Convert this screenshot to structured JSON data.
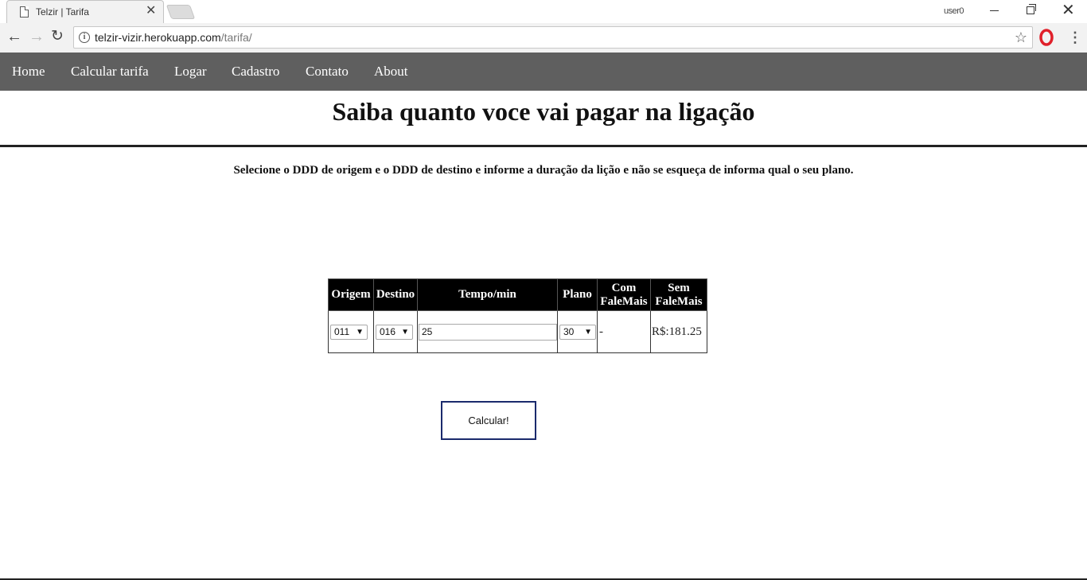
{
  "browser": {
    "tab_title": "Telzir | Tarifa",
    "user_label": "user0",
    "url_host": "telzir-vizir.herokuapp.com",
    "url_path": "/tarifa/"
  },
  "nav": {
    "items": [
      {
        "label": "Home"
      },
      {
        "label": "Calcular tarifa"
      },
      {
        "label": "Logar"
      },
      {
        "label": "Cadastro"
      },
      {
        "label": "Contato"
      },
      {
        "label": "About"
      }
    ]
  },
  "page": {
    "title": "Saiba quanto voce vai pagar na ligação",
    "instructions": "Selecione o DDD de origem e o DDD de destino e informe a duração da lição e não se esqueça de informa qual o seu plano."
  },
  "table": {
    "headers": {
      "origem": "Origem",
      "destino": "Destino",
      "tempo": "Tempo/min",
      "plano": "Plano",
      "com_1": "Com",
      "com_2": "FaleMais",
      "sem_1": "Sem",
      "sem_2": "FaleMais"
    },
    "row": {
      "origem": "011",
      "destino": "016",
      "tempo": "25",
      "plano": "30",
      "com_falemais": "-",
      "sem_falemais": "R$:181.25"
    }
  },
  "actions": {
    "calcular_label": "Calcular!"
  },
  "colors": {
    "nav_bg": "#5f5f5f",
    "header_bg": "#000000",
    "button_border": "#1a2a6c"
  }
}
